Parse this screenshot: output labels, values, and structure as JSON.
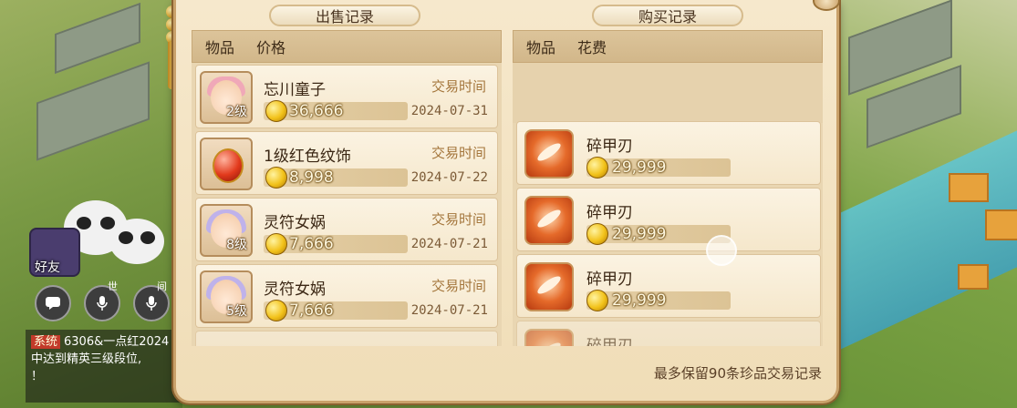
{
  "panel": {
    "sales_tab": "出售记录",
    "purchase_tab": "购买记录",
    "footer_note": "最多保留90条珍品交易记录"
  },
  "sales": {
    "col_item": "物品",
    "col_price": "价格",
    "rows": [
      {
        "name": "忘川童子",
        "level": "2级",
        "price": "36,666",
        "time_label": "交易时间",
        "date": "2024-07-31",
        "icon": "pet-portrait-pink"
      },
      {
        "name": "1级红色纹饰",
        "level": "",
        "price": "8,998",
        "time_label": "交易时间",
        "date": "2024-07-22",
        "icon": "red-gem"
      },
      {
        "name": "灵符女娲",
        "level": "8级",
        "price": "7,666",
        "time_label": "交易时间",
        "date": "2024-07-21",
        "icon": "pet-portrait-lilac"
      },
      {
        "name": "灵符女娲",
        "level": "5级",
        "price": "7,666",
        "time_label": "交易时间",
        "date": "2024-07-21",
        "icon": "pet-portrait-lilac"
      }
    ]
  },
  "purchases": {
    "col_item": "物品",
    "col_cost": "花费",
    "rows": [
      {
        "name": "碎甲刃",
        "price": "29,999",
        "icon": "blade-skill"
      },
      {
        "name": "碎甲刃",
        "price": "29,999",
        "icon": "blade-skill"
      },
      {
        "name": "碎甲刃",
        "price": "29,999",
        "icon": "blade-skill"
      },
      {
        "name": "碎甲刃",
        "price": "",
        "icon": "blade-skill"
      }
    ]
  },
  "hud": {
    "friend_label": "好友",
    "chat_tag": "系统",
    "chat_line1": "6306&一点红2024",
    "chat_line2": "中达到精英三级段位,",
    "chat_line3": "！",
    "btn_world": "世",
    "btn_team": "间"
  },
  "colors": {
    "panel_bg": "#f6e8cc",
    "panel_border": "#c9a16a",
    "coin": "#f2c21a"
  }
}
